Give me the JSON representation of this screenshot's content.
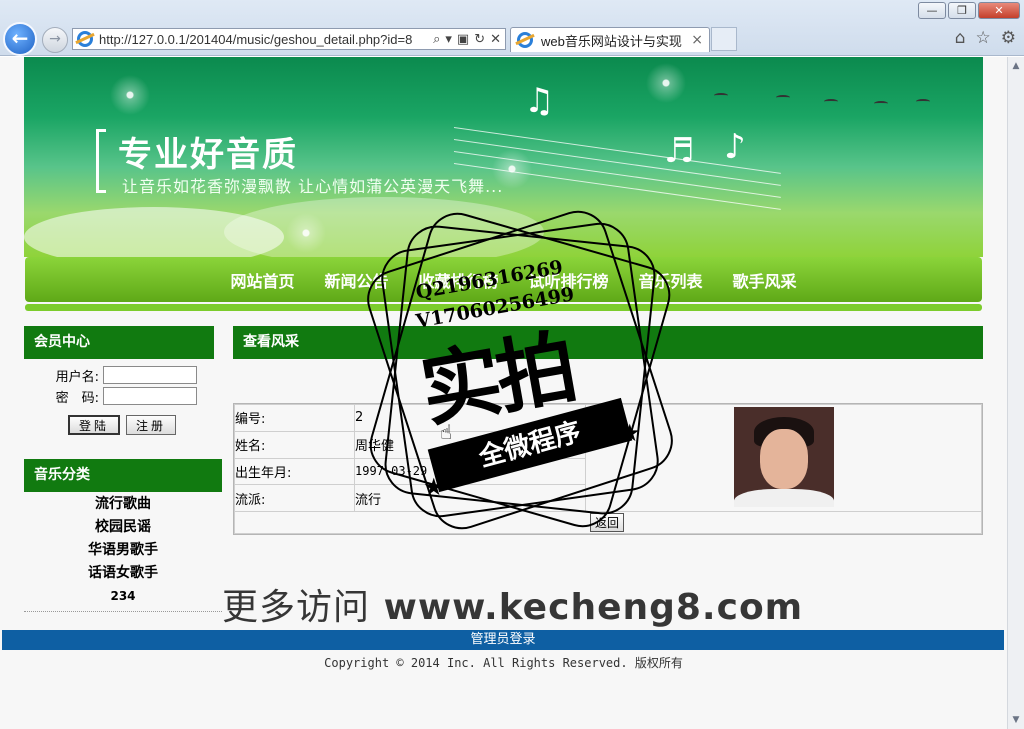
{
  "browser": {
    "url": "http://127.0.0.1/201404/music/geshou_detail.php?id=8",
    "tab_title": "web音乐网站设计与实现",
    "tab_close": "×",
    "window_buttons": [
      "—",
      "❐",
      "✕"
    ]
  },
  "banner": {
    "slogan": "专业好音质",
    "subtitle": "让音乐如花香弥漫飘散   让心情如蒲公英漫天飞舞..."
  },
  "nav": {
    "items": [
      "网站首页",
      "新闻公告",
      "收藏排行榜",
      "试听排行榜",
      "音乐列表",
      "歌手风采"
    ]
  },
  "member": {
    "title": "会员中心",
    "username_label": "用户名:",
    "password_label": "密　码:",
    "username_value": "",
    "password_value": "",
    "login_button": "登陆",
    "register_button": "注册"
  },
  "categories": {
    "title": "音乐分类",
    "items": [
      "流行歌曲",
      "校园民谣",
      "华语男歌手",
      "话语女歌手",
      "234"
    ]
  },
  "detail": {
    "title": "查看风采",
    "fields": [
      {
        "label": "编号:",
        "value": "2"
      },
      {
        "label": "姓名:",
        "value": "周华健"
      },
      {
        "label": "出生年月:",
        "value": "1997-03-29"
      },
      {
        "label": "流派:",
        "value": "流行"
      }
    ],
    "back_button": "返回"
  },
  "footer": {
    "admin_link": "管理员登录",
    "copyright": "Copyright © 2014 Inc. All Rights Reserved. 版权所有"
  },
  "watermark": {
    "qq": "Q2196316269",
    "vx": "V17060256499",
    "big": "实拍",
    "ribbon": "全微程序",
    "site_cn": "更多访问",
    "site": "www.kecheng8.com"
  },
  "colors": {
    "header_green": "#117a10",
    "nav_green": "#7ccc2c",
    "footer_blue": "#0e5fa3"
  }
}
